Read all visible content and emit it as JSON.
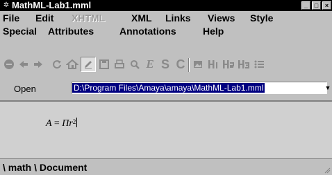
{
  "window": {
    "title": "MathML-Lab1.mml",
    "minimize_glyph": "_",
    "maximize_glyph": "□",
    "close_glyph": "×"
  },
  "menu": {
    "file": "File",
    "edit": "Edit",
    "xhtml": "XHTML",
    "xml": "XML",
    "links": "Links",
    "views": "Views",
    "style": "Style",
    "special": "Special",
    "attributes": "Attributes",
    "annotations": "Annotations",
    "help": "Help"
  },
  "toolbar": {
    "icons": [
      "stop-icon",
      "back-icon",
      "forward-icon",
      "reload-icon",
      "home-icon",
      "edit-mode-icon",
      "save-icon",
      "print-icon",
      "find-icon",
      "emphasis-icon",
      "strong-icon",
      "code-icon",
      "image-icon",
      "heading1-icon",
      "heading2-icon",
      "heading3-icon",
      "list-icon"
    ],
    "active": "edit-mode-icon"
  },
  "address": {
    "label": "Open",
    "value": "D:\\Program Files\\Amaya\\amaya\\MathML-Lab1.mml"
  },
  "document": {
    "formula_lhs": "A",
    "formula_eq": "=",
    "formula_pi": "Π",
    "formula_var": "r",
    "formula_exp": "2"
  },
  "status": {
    "path": "\\ math \\ Document"
  },
  "colors": {
    "titlebar": "#000000",
    "chrome": "#c0c0c0",
    "selection": "#000080",
    "document_bg": "#d0d0d0"
  }
}
